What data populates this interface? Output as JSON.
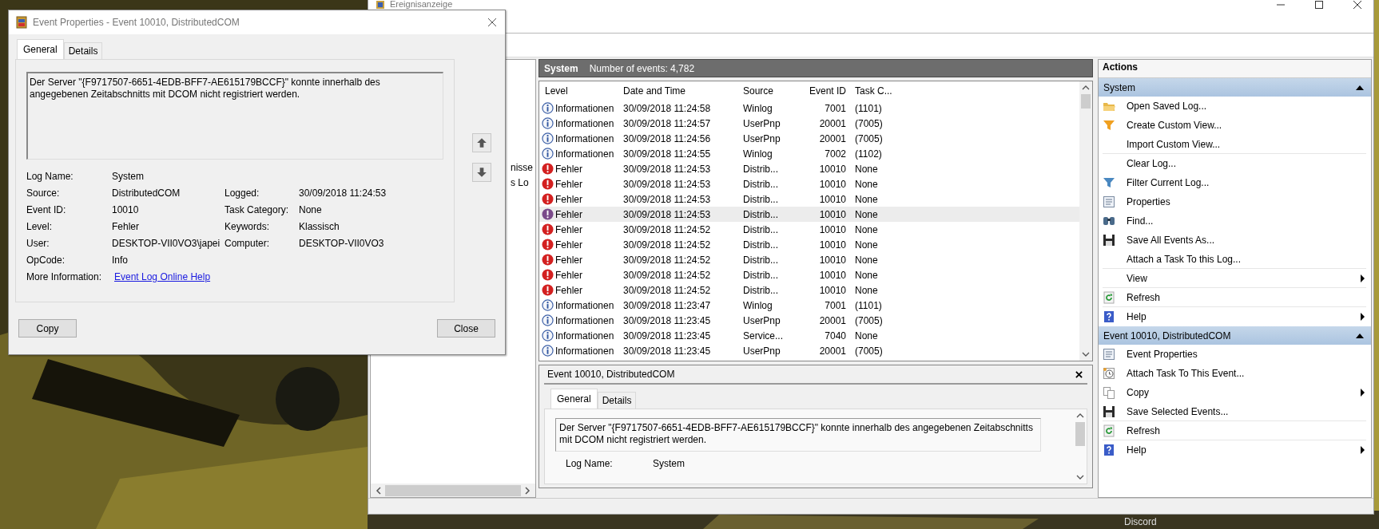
{
  "desktop": {
    "icon_label": "Discord"
  },
  "main_window": {
    "title": "Ereignisanzeige",
    "tree_fragments": [
      "nisse",
      "s Lo"
    ],
    "center_header": {
      "log": "System",
      "count": "Number of events: 4,782"
    },
    "events": {
      "columns": [
        "Level",
        "Date and Time",
        "Source",
        "Event ID",
        "Task C..."
      ],
      "rows": [
        {
          "kind": "info",
          "level": "Informationen",
          "date": "30/09/2018 11:24:58",
          "source": "Winlog",
          "event_id": "7001",
          "task": "(1101)",
          "selected": false
        },
        {
          "kind": "info",
          "level": "Informationen",
          "date": "30/09/2018 11:24:57",
          "source": "UserPnp",
          "event_id": "20001",
          "task": "(7005)",
          "selected": false
        },
        {
          "kind": "info",
          "level": "Informationen",
          "date": "30/09/2018 11:24:56",
          "source": "UserPnp",
          "event_id": "20001",
          "task": "(7005)",
          "selected": false
        },
        {
          "kind": "info",
          "level": "Informationen",
          "date": "30/09/2018 11:24:55",
          "source": "Winlog",
          "event_id": "7002",
          "task": "(1102)",
          "selected": false
        },
        {
          "kind": "error",
          "level": "Fehler",
          "date": "30/09/2018 11:24:53",
          "source": "Distrib...",
          "event_id": "10010",
          "task": "None",
          "selected": false
        },
        {
          "kind": "error",
          "level": "Fehler",
          "date": "30/09/2018 11:24:53",
          "source": "Distrib...",
          "event_id": "10010",
          "task": "None",
          "selected": false
        },
        {
          "kind": "error",
          "level": "Fehler",
          "date": "30/09/2018 11:24:53",
          "source": "Distrib...",
          "event_id": "10010",
          "task": "None",
          "selected": false
        },
        {
          "kind": "error",
          "level": "Fehler",
          "date": "30/09/2018 11:24:53",
          "source": "Distrib...",
          "event_id": "10010",
          "task": "None",
          "selected": true
        },
        {
          "kind": "error",
          "level": "Fehler",
          "date": "30/09/2018 11:24:52",
          "source": "Distrib...",
          "event_id": "10010",
          "task": "None",
          "selected": false
        },
        {
          "kind": "error",
          "level": "Fehler",
          "date": "30/09/2018 11:24:52",
          "source": "Distrib...",
          "event_id": "10010",
          "task": "None",
          "selected": false
        },
        {
          "kind": "error",
          "level": "Fehler",
          "date": "30/09/2018 11:24:52",
          "source": "Distrib...",
          "event_id": "10010",
          "task": "None",
          "selected": false
        },
        {
          "kind": "error",
          "level": "Fehler",
          "date": "30/09/2018 11:24:52",
          "source": "Distrib...",
          "event_id": "10010",
          "task": "None",
          "selected": false
        },
        {
          "kind": "error",
          "level": "Fehler",
          "date": "30/09/2018 11:24:52",
          "source": "Distrib...",
          "event_id": "10010",
          "task": "None",
          "selected": false
        },
        {
          "kind": "info",
          "level": "Informationen",
          "date": "30/09/2018 11:23:47",
          "source": "Winlog",
          "event_id": "7001",
          "task": "(1101)",
          "selected": false
        },
        {
          "kind": "info",
          "level": "Informationen",
          "date": "30/09/2018 11:23:45",
          "source": "UserPnp",
          "event_id": "20001",
          "task": "(7005)",
          "selected": false
        },
        {
          "kind": "info",
          "level": "Informationen",
          "date": "30/09/2018 11:23:45",
          "source": "Service...",
          "event_id": "7040",
          "task": "None",
          "selected": false
        },
        {
          "kind": "info",
          "level": "Informationen",
          "date": "30/09/2018 11:23:45",
          "source": "UserPnp",
          "event_id": "20001",
          "task": "(7005)",
          "selected": false
        }
      ]
    },
    "preview": {
      "title": "Event 10010, DistributedCOM",
      "tabs": [
        {
          "label": "General",
          "selected": true
        },
        {
          "label": "Details",
          "selected": false
        }
      ],
      "message": "Der Server \"{F9717507-6651-4EDB-BFF7-AE615179BCCF}\" konnte innerhalb des angegebenen Zeitabschnitts mit DCOM nicht registriert werden.",
      "fields": [
        {
          "label": "Log Name:",
          "value": "System"
        }
      ]
    },
    "actions": {
      "title": "Actions",
      "sections": [
        {
          "title": "System",
          "expanded": true,
          "items": [
            {
              "label": "Open Saved Log...",
              "kind": "folder",
              "submenu": false,
              "divider_after": false
            },
            {
              "label": "Create Custom View...",
              "kind": "newfilter",
              "submenu": false,
              "divider_after": false
            },
            {
              "label": "Import Custom View...",
              "kind": "plain",
              "submenu": false,
              "divider_after": true
            },
            {
              "label": "Clear Log...",
              "kind": "plain",
              "submenu": false,
              "divider_after": false
            },
            {
              "label": "Filter Current Log...",
              "kind": "filter",
              "submenu": false,
              "divider_after": false
            },
            {
              "label": "Properties",
              "kind": "properties",
              "submenu": false,
              "divider_after": false
            },
            {
              "label": "Find...",
              "kind": "find",
              "submenu": false,
              "divider_after": false
            },
            {
              "label": "Save All Events As...",
              "kind": "save",
              "submenu": false,
              "divider_after": false
            },
            {
              "label": "Attach a Task To this Log...",
              "kind": "plain",
              "submenu": false,
              "divider_after": true
            },
            {
              "label": "View",
              "kind": "plain",
              "submenu": true,
              "divider_after": true
            },
            {
              "label": "Refresh",
              "kind": "refresh",
              "submenu": false,
              "divider_after": true
            },
            {
              "label": "Help",
              "kind": "help",
              "submenu": true,
              "divider_after": false
            }
          ]
        },
        {
          "title": "Event 10010, DistributedCOM",
          "expanded": true,
          "items": [
            {
              "label": "Event Properties",
              "kind": "properties",
              "submenu": false,
              "divider_after": false
            },
            {
              "label": "Attach Task To This Event...",
              "kind": "task",
              "submenu": false,
              "divider_after": false
            },
            {
              "label": "Copy",
              "kind": "copy",
              "submenu": true,
              "divider_after": false
            },
            {
              "label": "Save Selected Events...",
              "kind": "save",
              "submenu": false,
              "divider_after": true
            },
            {
              "label": "Refresh",
              "kind": "refresh",
              "submenu": false,
              "divider_after": true
            },
            {
              "label": "Help",
              "kind": "help",
              "submenu": true,
              "divider_after": false
            }
          ]
        }
      ]
    }
  },
  "dialog": {
    "title": "Event Properties - Event 10010, DistributedCOM",
    "tabs": [
      {
        "label": "General",
        "selected": true
      },
      {
        "label": "Details",
        "selected": false
      }
    ],
    "message": "Der Server \"{F9717507-6651-4EDB-BFF7-AE615179BCCF}\" konnte innerhalb des angegebenen Zeitabschnitts mit DCOM nicht registriert werden.",
    "fields": [
      {
        "label": "Log Name:",
        "value": "System"
      },
      {
        "label": "Source:",
        "value": "DistributedCOM",
        "label2": "Logged:",
        "value2": "30/09/2018 11:24:53"
      },
      {
        "label": "Event ID:",
        "value": "10010",
        "label2": "Task Category:",
        "value2": "None"
      },
      {
        "label": "Level:",
        "value": "Fehler",
        "label2": "Keywords:",
        "value2": "Klassisch"
      },
      {
        "label": "User:",
        "value": "DESKTOP-VII0VO3\\japei",
        "label2": "Computer:",
        "value2": "DESKTOP-VII0VO3"
      },
      {
        "label": "OpCode:",
        "value": "Info"
      }
    ],
    "more_info": {
      "label": "More Information:",
      "link": "Event Log Online Help"
    },
    "buttons": [
      "Copy",
      "Close"
    ]
  }
}
